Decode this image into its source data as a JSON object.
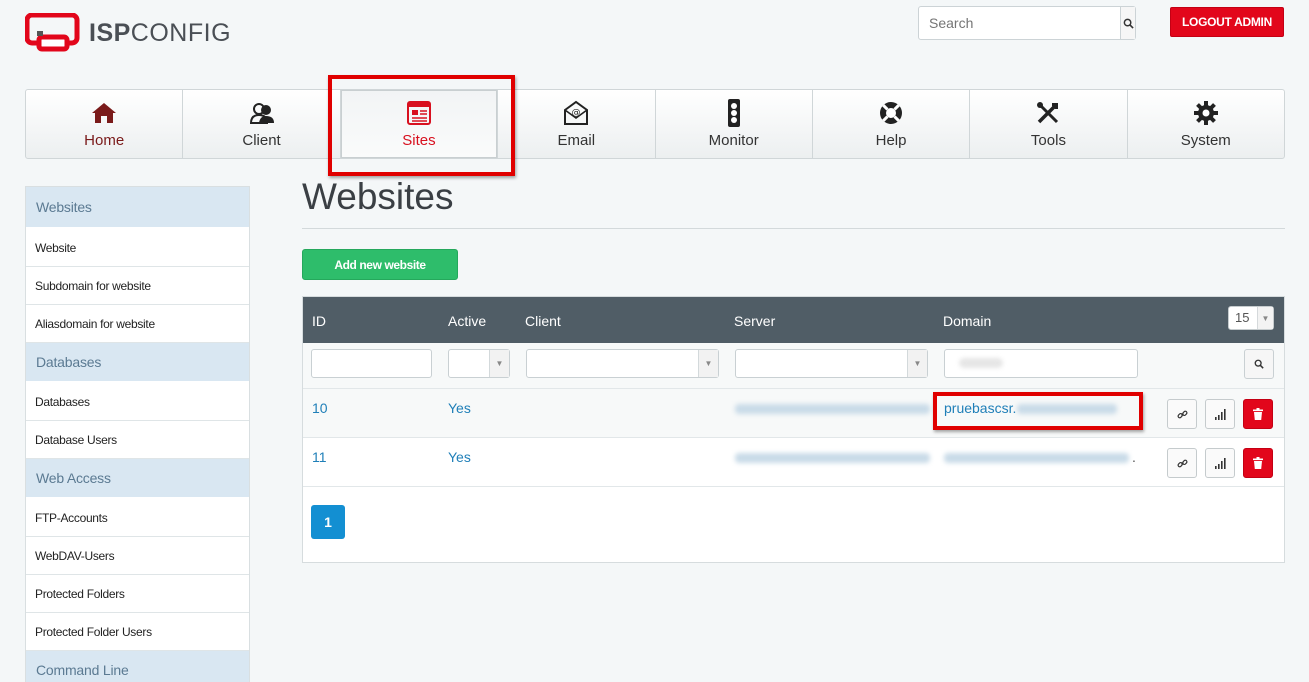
{
  "header": {
    "logo_bold": "ISP",
    "logo_light": "CONFIG",
    "search_placeholder": "Search",
    "logout_label": "LOGOUT ADMIN"
  },
  "nav": [
    {
      "label": "Home",
      "icon": "home-icon"
    },
    {
      "label": "Client",
      "icon": "client-icon"
    },
    {
      "label": "Sites",
      "icon": "sites-icon",
      "active": true
    },
    {
      "label": "Email",
      "icon": "email-icon"
    },
    {
      "label": "Monitor",
      "icon": "monitor-icon"
    },
    {
      "label": "Help",
      "icon": "help-icon"
    },
    {
      "label": "Tools",
      "icon": "tools-icon"
    },
    {
      "label": "System",
      "icon": "system-icon"
    }
  ],
  "sidebar": {
    "sections": [
      {
        "title": "Websites",
        "items": [
          "Website",
          "Subdomain for website",
          "Aliasdomain for website"
        ]
      },
      {
        "title": "Databases",
        "items": [
          "Databases",
          "Database Users"
        ]
      },
      {
        "title": "Web Access",
        "items": [
          "FTP-Accounts",
          "WebDAV-Users",
          "Protected Folders",
          "Protected Folder Users"
        ]
      },
      {
        "title": "Command Line",
        "items": []
      }
    ]
  },
  "main": {
    "title": "Websites",
    "add_button": "Add new website",
    "per_page": "15",
    "columns": [
      "ID",
      "Active",
      "Client",
      "Server",
      "Domain"
    ],
    "rows": [
      {
        "id": "10",
        "active": "Yes",
        "domain_visible": "pruebascsr."
      },
      {
        "id": "11",
        "active": "Yes",
        "domain_visible": "."
      }
    ],
    "page": "1"
  },
  "colors": {
    "accent_red": "#e2061b",
    "add_green": "#2ebd6b",
    "table_header": "#505d66",
    "link_blue": "#1f7fb8",
    "pager_blue": "#138fd2",
    "sidebar_head": "#d9e7f2"
  }
}
